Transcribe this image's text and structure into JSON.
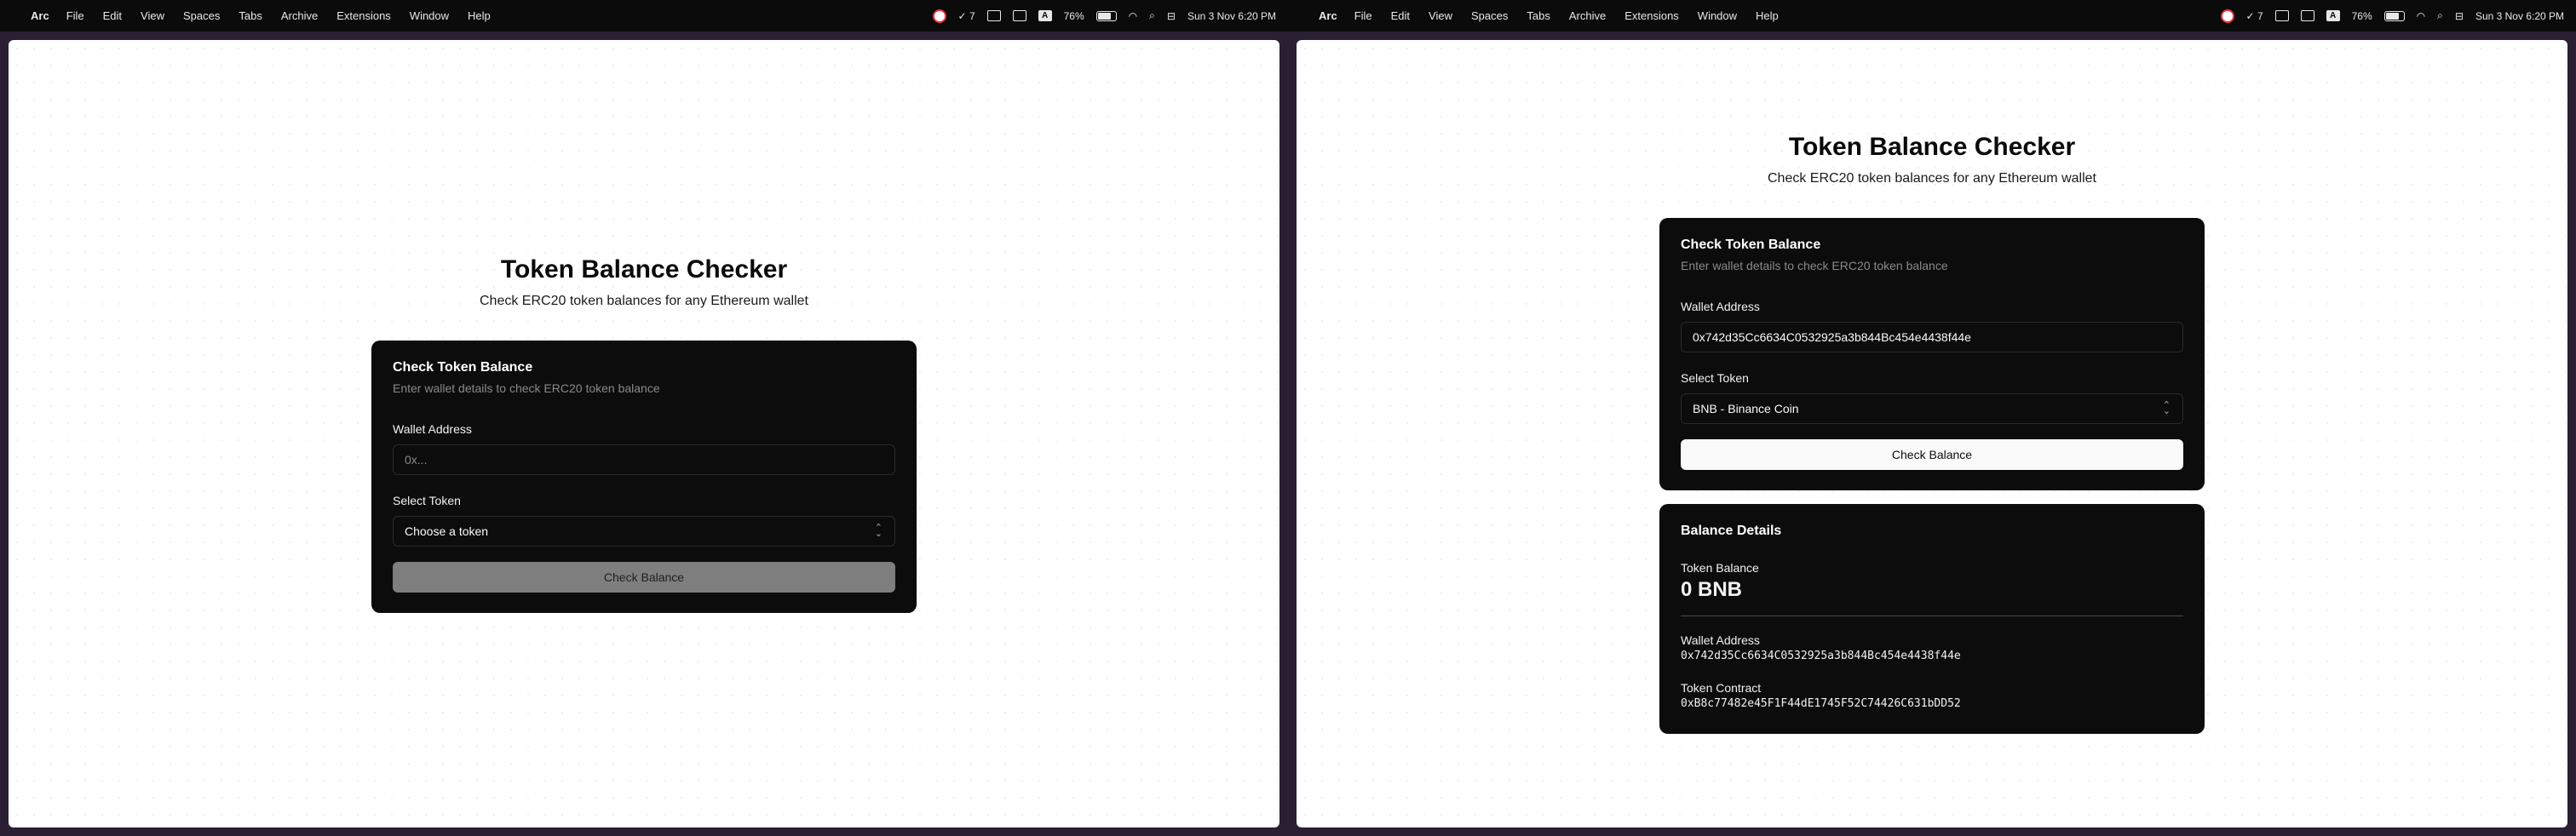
{
  "menubar": {
    "app_name": "Arc",
    "items": [
      "File",
      "Edit",
      "View",
      "Spaces",
      "Tabs",
      "Archive",
      "Extensions",
      "Window",
      "Help"
    ],
    "status": {
      "badge_count": "7",
      "text_icon": "A",
      "battery": "76%",
      "datetime": "Sun 3 Nov  6:20 PM"
    }
  },
  "app": {
    "title": "Token Balance Checker",
    "subtitle": "Check ERC20 token balances for any Ethereum wallet"
  },
  "form": {
    "title": "Check Token Balance",
    "description": "Enter wallet details to check ERC20 token balance",
    "wallet_label": "Wallet Address",
    "wallet_placeholder": "0x...",
    "token_label": "Select Token",
    "token_placeholder": "Choose a token",
    "button": "Check Balance"
  },
  "filled": {
    "wallet_value": "0x742d35Cc6634C0532925a3b844Bc454e4438f44e",
    "token_value": "BNB - Binance Coin"
  },
  "balance": {
    "title": "Balance Details",
    "token_balance_label": "Token Balance",
    "token_balance_value": "0 BNB",
    "wallet_label": "Wallet Address",
    "wallet_value": "0x742d35Cc6634C0532925a3b844Bc454e4438f44e",
    "contract_label": "Token Contract",
    "contract_value": "0xB8c77482e45F1F44dE1745F52C74426C631bDD52"
  }
}
